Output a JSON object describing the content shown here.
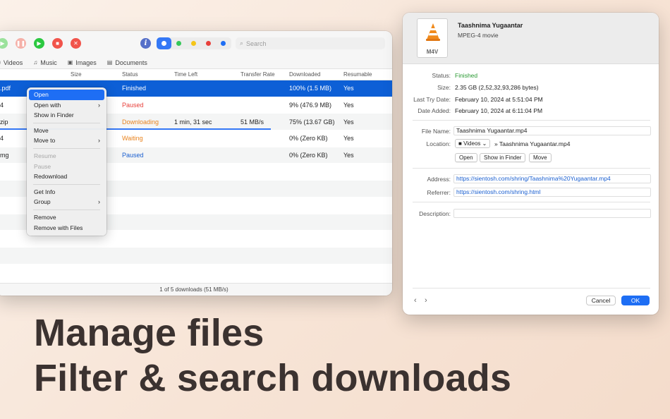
{
  "toolbar": {
    "search_placeholder": "Search",
    "filter_colors": [
      "#ffffff",
      "#34c759",
      "#f5c518",
      "#e8403b",
      "#1e6ef4"
    ]
  },
  "categories": [
    {
      "label": "Videos",
      "icon": "video-icon"
    },
    {
      "label": "Music",
      "icon": "music-icon"
    },
    {
      "label": "Images",
      "icon": "image-icon"
    },
    {
      "label": "Documents",
      "icon": "document-icon"
    }
  ],
  "columns": {
    "size": "Size",
    "status": "Status",
    "time_left": "Time Left",
    "transfer_rate": "Transfer Rate",
    "downloaded": "Downloaded",
    "resumable": "Resumable"
  },
  "rows": [
    {
      "name": ".pdf",
      "status": "Finished",
      "time_left": "",
      "rate": "",
      "downloaded": "100% (1.5 MB)",
      "resumable": "Yes",
      "status_color": "#ffffff"
    },
    {
      "name": "4",
      "status": "Paused",
      "time_left": "",
      "rate": "",
      "downloaded": "9% (476.9 MB)",
      "resumable": "Yes",
      "status_color": "#e8403b"
    },
    {
      "name": "zip",
      "status": "Downloading",
      "time_left": "1 min, 31 sec",
      "rate": "51 MB/s",
      "downloaded": "75% (13.67 GB)",
      "resumable": "Yes",
      "status_color": "#e98420",
      "progress": 0.75
    },
    {
      "name": "4",
      "status": "Waiting",
      "time_left": "",
      "rate": "",
      "downloaded": "0% (Zero KB)",
      "resumable": "Yes",
      "status_color": "#e98420"
    },
    {
      "name": "mg",
      "status": "Paused",
      "time_left": "",
      "rate": "",
      "downloaded": "0% (Zero KB)",
      "resumable": "Yes",
      "status_color": "#1a5fd0"
    }
  ],
  "statusbar": "1 of 5 downloads (51 MB/s)",
  "context_menu": {
    "open": "Open",
    "open_with": "Open with",
    "show_in_finder": "Show in Finder",
    "move": "Move",
    "move_to": "Move to",
    "resume": "Resume",
    "pause": "Pause",
    "redownload": "Redownload",
    "get_info": "Get Info",
    "group": "Group",
    "remove": "Remove",
    "remove_with_files": "Remove with Files"
  },
  "info": {
    "file_title": "Taashnima Yugaantar",
    "file_type": "MPEG-4 movie",
    "file_ext": "M4V",
    "labels": {
      "status": "Status:",
      "size": "Size:",
      "last_try": "Last Try Date:",
      "date_added": "Date Added:",
      "file_name": "File Name:",
      "location": "Location:",
      "address": "Address:",
      "referrer": "Referrer:",
      "description": "Description:"
    },
    "status": "Finished",
    "size": "2.35 GB (2,52,32,93,286 bytes)",
    "last_try": "February 10, 2024 at 5:51:04 PM",
    "date_added": "February 10, 2024 at 6:11:04 PM",
    "file_name": "Taashnima Yugaantar.mp4",
    "location_folder": "Videos",
    "location_path": "» Taashnima Yugaantar.mp4",
    "btn_open": "Open",
    "btn_show_in_finder": "Show in Finder",
    "btn_move": "Move",
    "address": "https://sientosh.com/shring/Taashnima%20Yugaantar.mp4",
    "referrer": "https://sientosh.com/shring.html",
    "description": "",
    "cancel": "Cancel",
    "ok": "OK"
  },
  "headline": {
    "line1": "Manage files",
    "line2": "Filter & search downloads"
  }
}
